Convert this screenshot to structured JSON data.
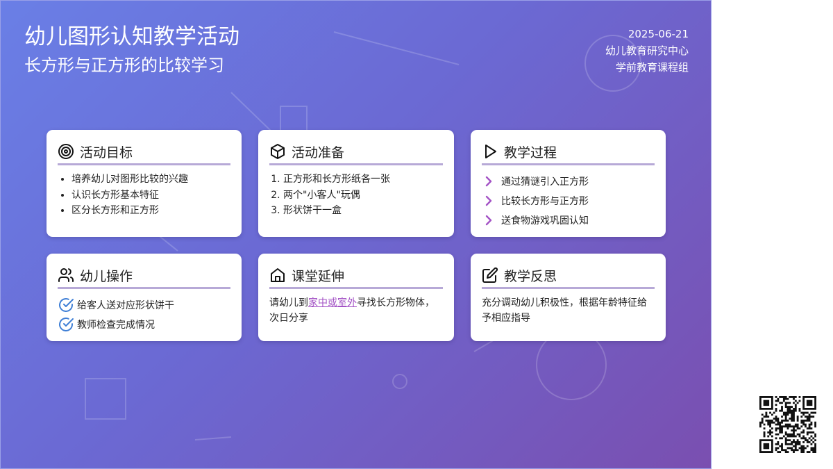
{
  "header": {
    "title": "幼儿图形认知教学活动",
    "subtitle": "长方形与正方形的比较学习",
    "date": "2025-06-21",
    "org": "幼儿教育研究中心",
    "group": "学前教育课程组"
  },
  "cards": {
    "goals": {
      "title": "活动目标",
      "items": [
        "培养幼儿对图形比较的兴趣",
        "认识长方形基本特征",
        "区分长方形和正方形"
      ]
    },
    "prep": {
      "title": "活动准备",
      "items": [
        "正方形和长方形纸各一张",
        "两个\"小客人\"玩偶",
        "形状饼干一盒"
      ]
    },
    "process": {
      "title": "教学过程",
      "items": [
        "通过猜谜引入正方形",
        "比较长方形与正方形",
        "送食物游戏巩固认知"
      ]
    },
    "operation": {
      "title": "幼儿操作",
      "items": [
        "给客人送对应形状饼干",
        "教师检查完成情况"
      ]
    },
    "extension": {
      "title": "课堂延伸",
      "text_before": "请幼儿到",
      "link": "家中或室外",
      "text_after": "寻找长方形物体，次日分享"
    },
    "reflection": {
      "title": "教学反思",
      "text": "充分调动幼儿积极性，根据年龄特征给予相应指导"
    }
  },
  "colors": {
    "accent": "#a352c5",
    "check": "#3f7fd6",
    "gradient_start": "#6a7fe6",
    "gradient_end": "#7a4fb0"
  },
  "icons": {
    "goals": "target-icon",
    "prep": "box-icon",
    "process": "play-icon",
    "operation": "users-icon",
    "extension": "home-icon",
    "reflection": "edit-icon",
    "process_bullet": "chevron-right-icon",
    "operation_bullet": "check-circle-icon"
  }
}
